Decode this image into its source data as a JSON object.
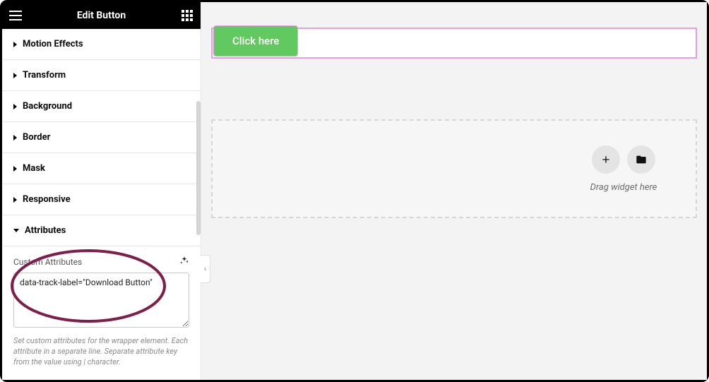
{
  "header": {
    "title": "Edit Button"
  },
  "panels": {
    "motion_effects": "Motion Effects",
    "transform": "Transform",
    "background": "Background",
    "border": "Border",
    "mask": "Mask",
    "responsive": "Responsive",
    "attributes": "Attributes"
  },
  "attributes": {
    "field_label": "Custom Attributes",
    "value": "data-track-label=\"Download Button\"",
    "help": "Set custom attributes for the wrapper element. Each attribute in a separate line. Separate attribute key from the value using | character."
  },
  "canvas": {
    "button_label": "Click here",
    "drop_hint": "Drag widget here"
  }
}
